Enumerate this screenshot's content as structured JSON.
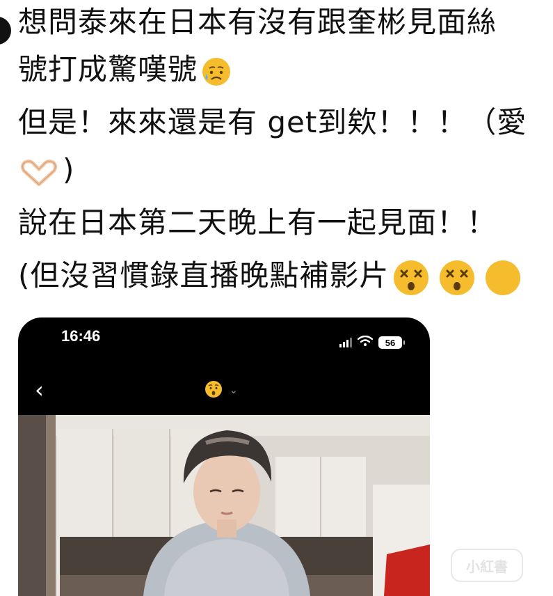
{
  "post": {
    "lines": [
      "想問泰來在日本有沒有跟奎彬見面絲",
      "號打成驚嘆號",
      "但是！來來還是有 get到欸！！！（愛",
      ")",
      "說在日本第二天晚上有一起見面！！",
      "(但沒習慣錄直播晚點補影片"
    ],
    "emojis": [
      "sad-relieved-face",
      "heart-hands",
      "dizzy-face",
      "dizzy-face",
      "hushed-face"
    ]
  },
  "screenshot": {
    "status_time": "16:46",
    "battery_level": "56",
    "signal_bars": 4,
    "wifi": true,
    "header_emoji": "hushed-face"
  },
  "watermark": {
    "text": "小紅書"
  },
  "colors": {
    "background": "#ffffff",
    "text": "#111111",
    "phone_bg": "#000000",
    "emoji_yellow": "#f5bd2e"
  }
}
